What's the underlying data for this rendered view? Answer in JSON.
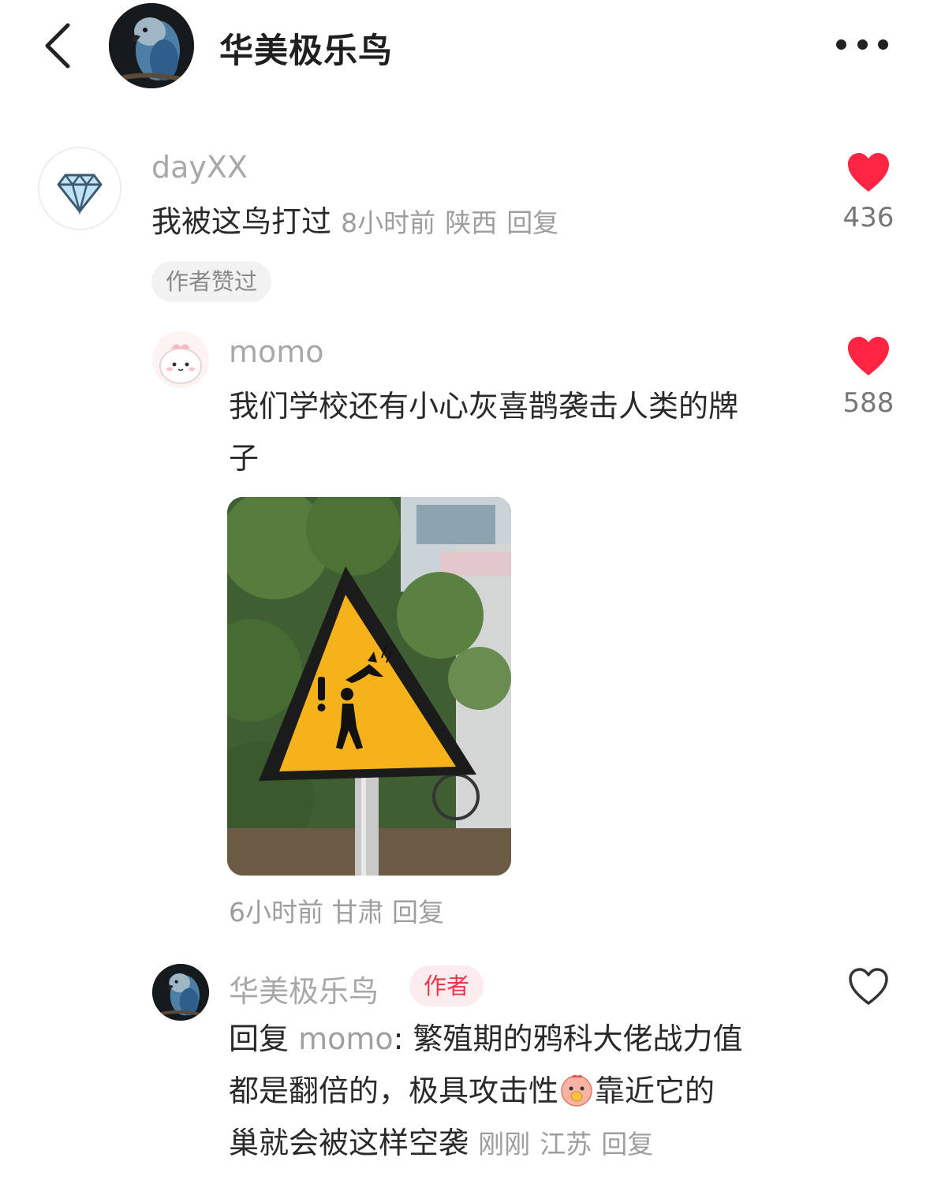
{
  "header": {
    "title": "华美极乐鸟",
    "back_icon": "chevron-left-icon",
    "more_icon": "more-horizontal-icon"
  },
  "comments": [
    {
      "username": "dayXX",
      "text": "我被这鸟打过",
      "time": "8小时前",
      "location": "陕西",
      "reply_label": "回复",
      "tag": "作者赞过",
      "likes": "436",
      "liked": true,
      "avatar_icon": "diamond-icon"
    },
    {
      "username": "momo",
      "text_line1": "我们学校还有小心灰喜鹊袭击人类的牌",
      "text_line2": "子",
      "time": "6小时前",
      "location": "甘肃",
      "reply_label": "回复",
      "likes": "588",
      "liked": true,
      "image_desc_icon": "warning-sign-photo"
    },
    {
      "username": "华美极乐鸟",
      "badge": "作者",
      "reply_prefix": "回复",
      "mention": "momo",
      "text_part1": ": 繁殖期的鸦科大佬战力值",
      "text_part2": "都是翻倍的，极具攻击性",
      "text_part3": "靠近它的",
      "text_part4": "巢就会被这样空袭",
      "time": "刚刚",
      "location": "江苏",
      "reply_label": "回复",
      "liked": false
    }
  ],
  "colors": {
    "like_red": "#ff2442",
    "author_badge_bg": "#fdecee",
    "author_badge_text": "#e8384a",
    "sign_yellow": "#f6b319"
  }
}
